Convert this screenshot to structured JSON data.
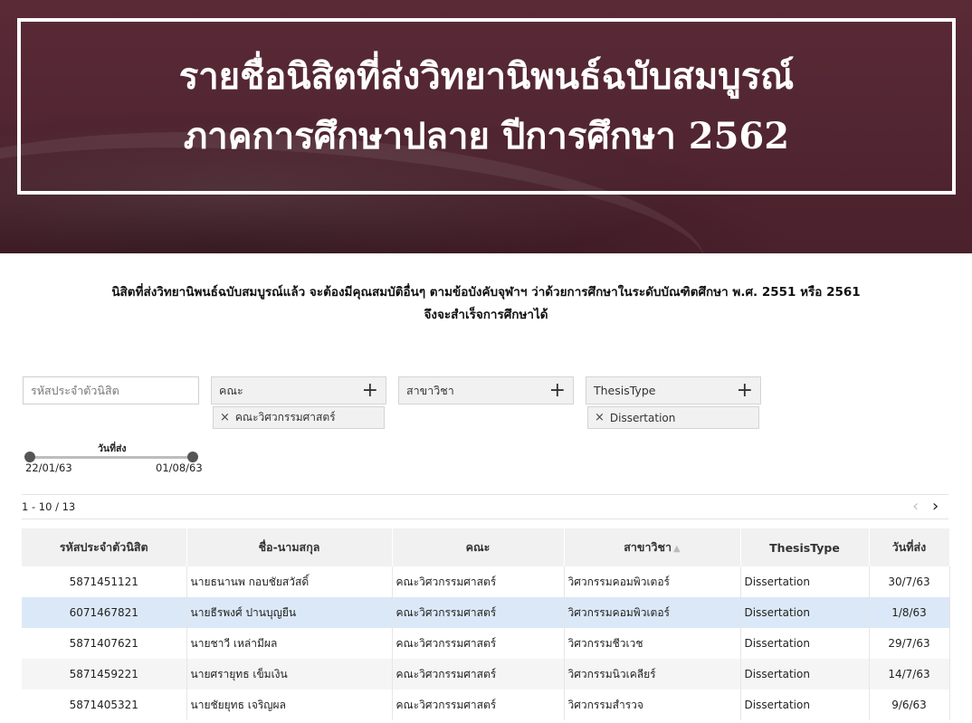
{
  "hero": {
    "title_line1": "รายชื่อนิสิตที่ส่งวิทยานิพนธ์ฉบับสมบูรณ์",
    "title_line2": "ภาคการศึกษาปลาย ปีการศึกษา 2562"
  },
  "notice": {
    "line1": "นิสิตที่ส่งวิทยานิพนธ์ฉบับสมบูรณ์แล้ว จะต้องมีคุณสมบัติอื่นๆ ตามข้อบังคับจุฬาฯ ว่าด้วยการศึกษาในระดับบัณฑิตศึกษา พ.ศ. 2551 หรือ 2561",
    "line2": "จึงจะสำเร็จการศึกษาได้"
  },
  "filters": {
    "student_id_placeholder": "รหัสประจำตัวนิสิต",
    "faculty_label": "คณะ",
    "faculty_chip": "คณะวิศวกรรมศาสตร์",
    "major_label": "สาขาวิชา",
    "thesis_type_label": "ThesisType",
    "thesis_type_chip": "Dissertation",
    "plus_icon": "+",
    "remove_icon": "×"
  },
  "date_slider": {
    "title": "วันที่ส่ง",
    "start": "22/01/63",
    "end": "01/08/63"
  },
  "pagination": {
    "range_text": "1 - 10 / 13",
    "prev_icon": "‹",
    "next_icon": "›"
  },
  "table": {
    "headers": [
      "รหัสประจำตัวนิสิต",
      "ชื่อ-นามสกุล",
      "คณะ",
      "สาขาวิชา",
      "ThesisType",
      "วันที่ส่ง"
    ],
    "sort_icon": "▲",
    "rows": [
      [
        "5871451121",
        "นายธนานพ กอบชัยสวัสดิ์",
        "คณะวิศวกรรมศาสตร์",
        "วิศวกรรมคอมพิวเตอร์",
        "Dissertation",
        "30/7/63"
      ],
      [
        "6071467821",
        "นายธีรพงศ์ ปานบุญยืน",
        "คณะวิศวกรรมศาสตร์",
        "วิศวกรรมคอมพิวเตอร์",
        "Dissertation",
        "1/8/63"
      ],
      [
        "5871407621",
        "นายชาวี เหล่ามีผล",
        "คณะวิศวกรรมศาสตร์",
        "วิศวกรรมชีวเวช",
        "Dissertation",
        "29/7/63"
      ],
      [
        "5871459221",
        "นายศรายุทธ เข็มเงิน",
        "คณะวิศวกรรมศาสตร์",
        "วิศวกรรมนิวเคลียร์",
        "Dissertation",
        "14/7/63"
      ],
      [
        "5871405321",
        "นายชัยยุทธ เจริญผล",
        "คณะวิศวกรรมศาสตร์",
        "วิศวกรรมสำรวจ",
        "Dissertation",
        "9/6/63"
      ]
    ]
  },
  "colors": {
    "banner": "#532633",
    "selected_row": "#dbe8f7",
    "header_bg": "#f1f1f1"
  }
}
